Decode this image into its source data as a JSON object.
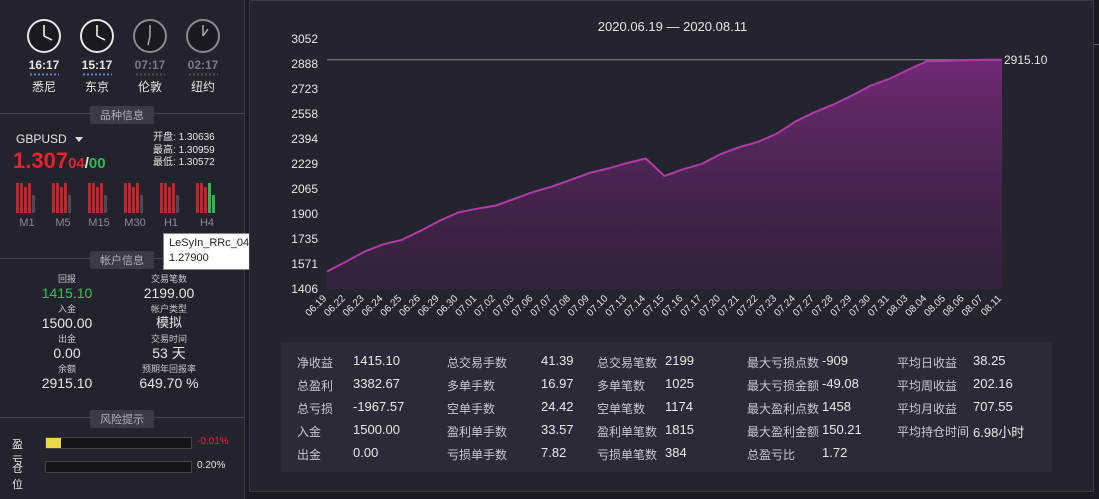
{
  "clocks": [
    {
      "time": "16:17",
      "city": "悉尼",
      "active": true
    },
    {
      "time": "15:17",
      "city": "东京",
      "active": true
    },
    {
      "time": "07:17",
      "city": "伦敦",
      "active": false
    },
    {
      "time": "02:17",
      "city": "纽约",
      "active": false
    }
  ],
  "sections": {
    "symbol_info": "品种信息",
    "account_info": "帐户信息",
    "risk": "风险提示"
  },
  "symbol": {
    "name": "GBPUSD",
    "price_main": "1.307",
    "price_frac1": "04",
    "price_sep": "/",
    "price_frac2": "00",
    "open_label": "开盘:",
    "open": "1.30636",
    "high_label": "最高:",
    "high": "1.30959",
    "low_label": "最低:",
    "low": "1.30572"
  },
  "timeframes": [
    "M1",
    "M5",
    "M15",
    "M30",
    "H1",
    "H4"
  ],
  "tooltip": {
    "line1": "LeSyIn_RRc_042",
    "line2": "1.27900"
  },
  "account": [
    {
      "label": "回报",
      "value": "1415.10",
      "green": true
    },
    {
      "label": "交易笔数",
      "value": "2199.00"
    },
    {
      "label": "入金",
      "value": "1500.00"
    },
    {
      "label": "帐户类型",
      "value": "模拟"
    },
    {
      "label": "出金",
      "value": "0.00"
    },
    {
      "label": "交易时间",
      "value": "53 天"
    },
    {
      "label": "余额",
      "value": "2915.10"
    },
    {
      "label": "预期年回报率",
      "value": "649.70 %"
    }
  ],
  "risk": [
    {
      "label": "盈亏",
      "value": "-0.01%",
      "color": "#e8232d",
      "level": 0.01
    },
    {
      "label": "仓位",
      "value": "0.20%",
      "color": "#e6e6e6",
      "level": 0.002
    }
  ],
  "colors": {
    "accent": "#b03aa8",
    "up": "#35c05c",
    "down": "#e8232d"
  },
  "chart_data": {
    "type": "area",
    "title": "2020.06.19 — 2020.08.11",
    "yticks": [
      1406,
      1571,
      1735,
      1900,
      2065,
      2229,
      2394,
      2558,
      2723,
      2888,
      3052
    ],
    "ylim": [
      1406,
      3052
    ],
    "last_value_label": "2915.10",
    "x": [
      "06.19",
      "06.22",
      "06.23",
      "06.24",
      "06.25",
      "06.26",
      "06.29",
      "06.30",
      "07.01",
      "07.02",
      "07.03",
      "07.06",
      "07.07",
      "07.08",
      "07.09",
      "07.10",
      "07.13",
      "07.14",
      "07.15",
      "07.16",
      "07.17",
      "07.20",
      "07.21",
      "07.22",
      "07.23",
      "07.24",
      "07.27",
      "07.28",
      "07.29",
      "07.30",
      "07.31",
      "08.03",
      "08.04",
      "08.05",
      "08.06",
      "08.07",
      "08.11"
    ],
    "y": [
      1521,
      1585,
      1652,
      1700,
      1730,
      1790,
      1855,
      1910,
      1935,
      1955,
      2000,
      2045,
      2080,
      2125,
      2170,
      2200,
      2235,
      2265,
      2150,
      2195,
      2230,
      2295,
      2340,
      2375,
      2430,
      2510,
      2570,
      2620,
      2680,
      2745,
      2790,
      2850,
      2905,
      2908,
      2912,
      2915,
      2915
    ],
    "grid": false
  },
  "stats": [
    {
      "label": "净收益",
      "value": "1415.10"
    },
    {
      "label": "总盈利",
      "value": "3382.67"
    },
    {
      "label": "总亏损",
      "value": "-1967.57"
    },
    {
      "label": "入金",
      "value": "1500.00"
    },
    {
      "label": "出金",
      "value": "0.00"
    },
    {
      "label": "总交易手数",
      "value": "41.39"
    },
    {
      "label": "多单手数",
      "value": "16.97"
    },
    {
      "label": "空单手数",
      "value": "24.42"
    },
    {
      "label": "盈利单手数",
      "value": "33.57"
    },
    {
      "label": "亏损单手数",
      "value": "7.82"
    },
    {
      "label": "总交易笔数",
      "value": "2199"
    },
    {
      "label": "多单笔数",
      "value": "1025"
    },
    {
      "label": "空单笔数",
      "value": "1174"
    },
    {
      "label": "盈利单笔数",
      "value": "1815"
    },
    {
      "label": "亏损单笔数",
      "value": "384"
    },
    {
      "label": "最大亏损点数",
      "value": "-909"
    },
    {
      "label": "最大亏损金额",
      "value": "-49.08"
    },
    {
      "label": "最大盈利点数",
      "value": "1458"
    },
    {
      "label": "最大盈利金额",
      "value": "150.21"
    },
    {
      "label": "总盈亏比",
      "value": "1.72"
    },
    {
      "label": "平均日收益",
      "value": "38.25"
    },
    {
      "label": "平均周收益",
      "value": "202.16"
    },
    {
      "label": "平均月收益",
      "value": "707.55"
    },
    {
      "label": "平均持仓时间",
      "value": "6.98小时"
    }
  ]
}
